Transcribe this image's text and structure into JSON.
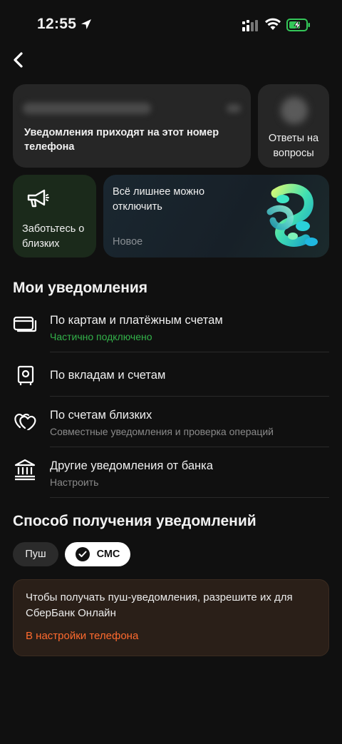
{
  "status_bar": {
    "time": "12:55",
    "icons": [
      "location-arrow-icon",
      "cellular-signal-icon",
      "wifi-icon",
      "battery-charging-icon"
    ],
    "battery_color": "#34c759"
  },
  "header": {
    "back_icon": "chevron-left-icon"
  },
  "cards": {
    "phone": {
      "title": "Уведомления приходят на этот номер телефона"
    },
    "faq": {
      "title": "Ответы на вопросы"
    },
    "care": {
      "title": "Заботьтесь о близких",
      "icon": "megaphone-icon"
    },
    "promo": {
      "title": "Всё лишнее можно отключить",
      "badge": "Новое"
    }
  },
  "my_notifications": {
    "title": "Мои уведомления",
    "items": [
      {
        "icon": "cards-icon",
        "label": "По картам и платёжным счетам",
        "sub": "Частично подключено",
        "sub_color": "#33b24a"
      },
      {
        "icon": "safe-icon",
        "label": "По вкладам и счетам",
        "sub": ""
      },
      {
        "icon": "hearts-icon",
        "label": "По счетам близких",
        "sub": "Совместные уведомления и проверка операций"
      },
      {
        "icon": "bank-icon",
        "label": "Другие уведомления от банка",
        "sub": "Настроить"
      }
    ]
  },
  "delivery": {
    "title": "Способ получения уведомлений",
    "options": [
      {
        "label": "Пуш",
        "selected": false
      },
      {
        "label": "СМС",
        "selected": true
      }
    ],
    "warning": {
      "text": "Чтобы получать пуш-уведомления, разрешите их для СберБанк Онлайн",
      "link": "В настройки телефона",
      "link_color": "#ff6a2e"
    }
  }
}
